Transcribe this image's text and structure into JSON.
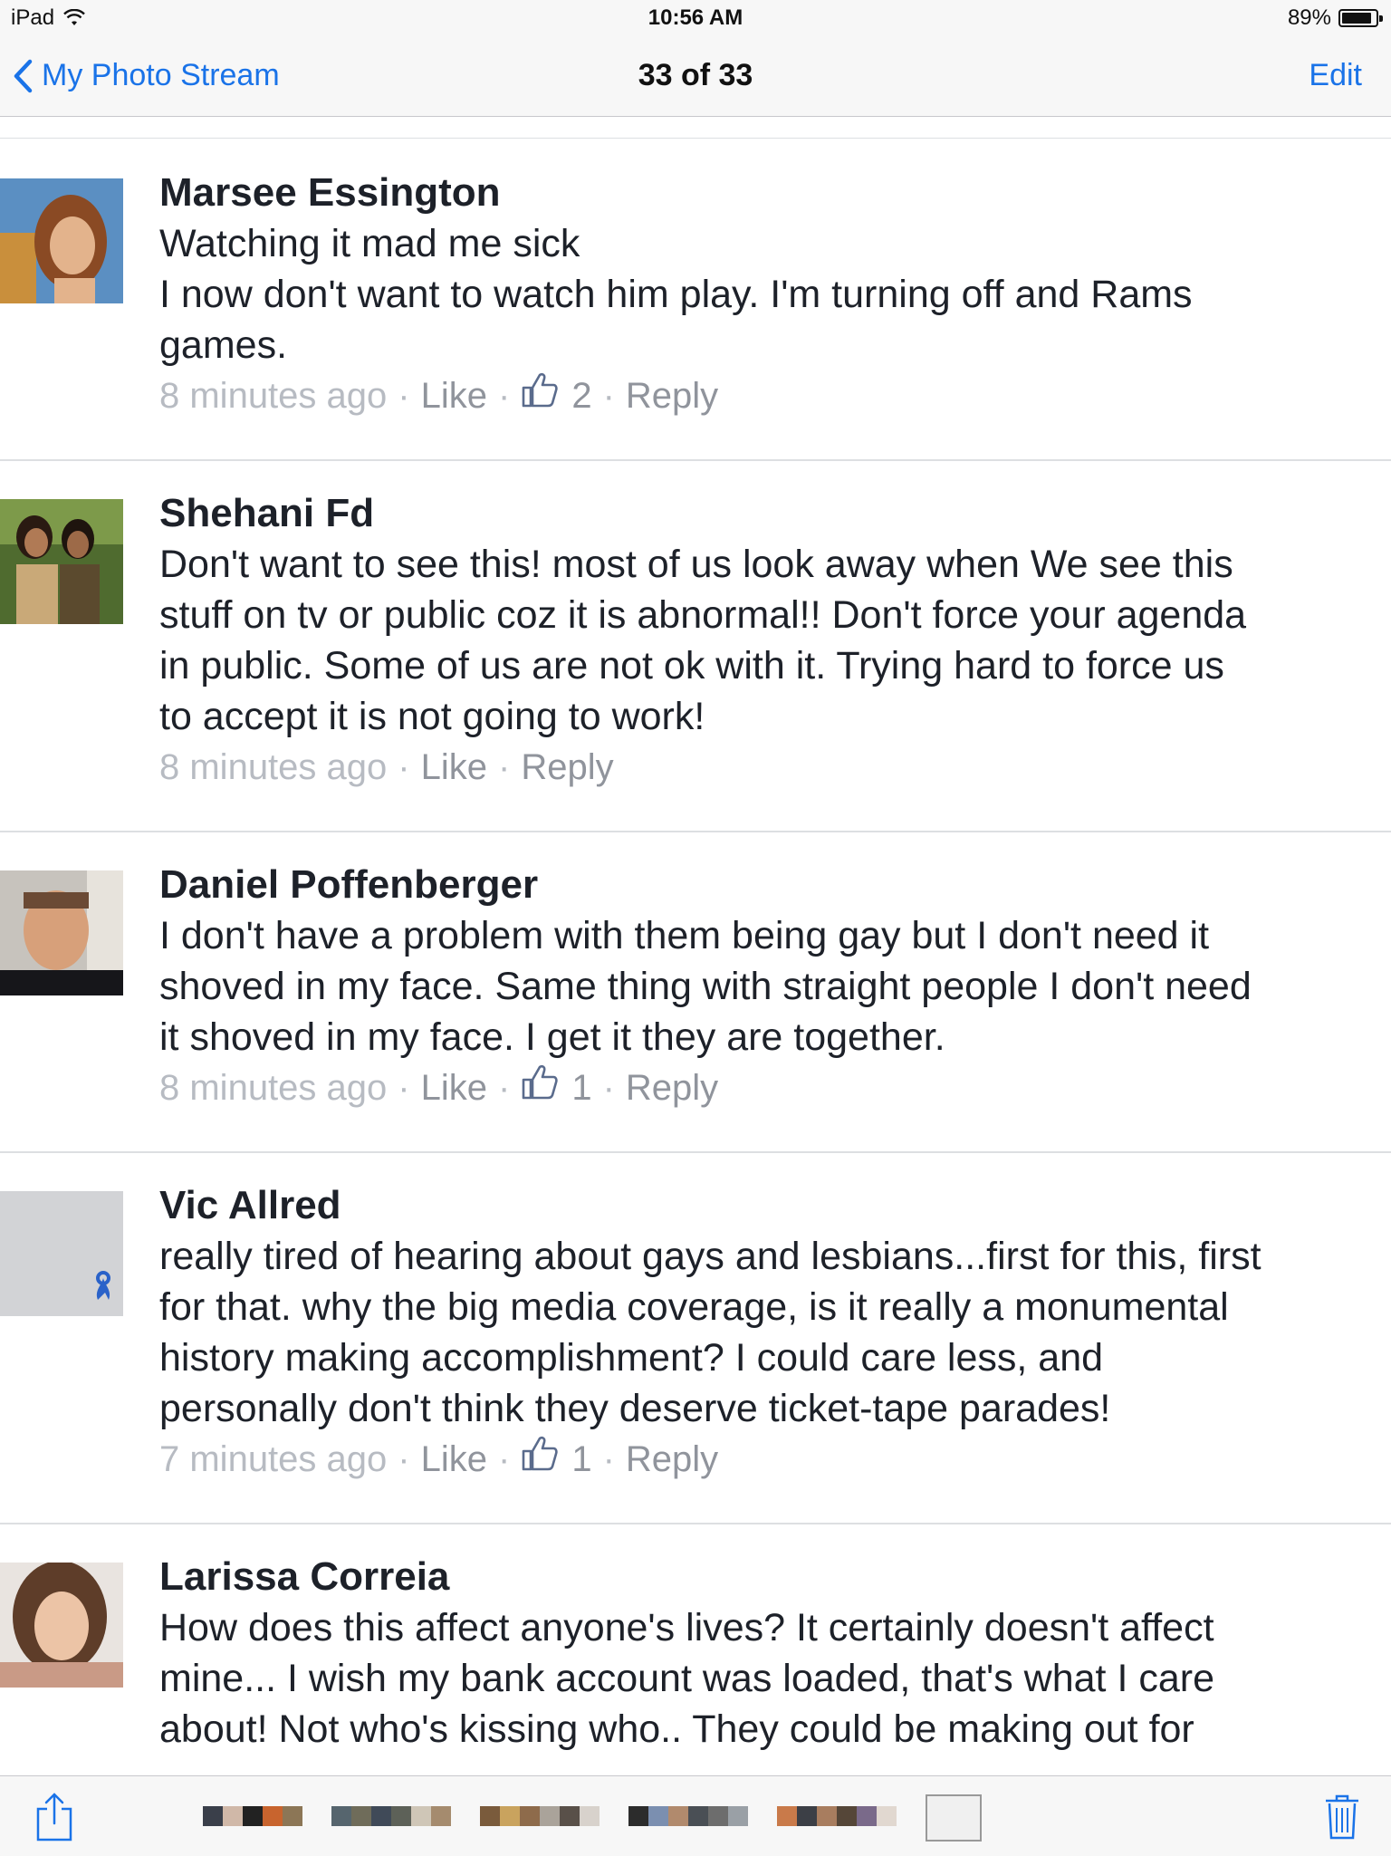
{
  "status_bar": {
    "device": "iPad",
    "time": "10:56 AM",
    "battery": "89%",
    "battery_level": 0.89
  },
  "nav": {
    "back_label": "My Photo Stream",
    "title": "33 of 33",
    "edit_label": "Edit"
  },
  "comments": [
    {
      "name": "Marsee Essington",
      "lines": [
        "Watching it mad me sick",
        "I now don't want to watch him play. I'm turning off and Rams",
        "games."
      ],
      "time": "8 minutes ago",
      "like": "Like",
      "likes": "2",
      "reply": "Reply"
    },
    {
      "name": "Shehani Fd",
      "lines": [
        "Don't want to see this! most of us look away when We see this",
        "stuff on tv or public coz it is abnormal!! Don't force your agenda",
        "in public. Some of us are not ok with it. Trying hard to force us",
        "to accept it is not going to work!"
      ],
      "time": "8 minutes ago",
      "like": "Like",
      "likes": "",
      "reply": "Reply"
    },
    {
      "name": "Daniel Poffenberger",
      "lines": [
        "I don't have a problem with them being gay but I don't need it",
        "shoved in my face. Same thing with straight people I don't need",
        "it shoved in my face. I get it they are together."
      ],
      "time": "8 minutes ago",
      "like": "Like",
      "likes": "1",
      "reply": "Reply"
    },
    {
      "name": "Vic Allred",
      "lines": [
        "really tired of hearing about gays and lesbians...first for this, first",
        "for that. why the big media coverage, is it really a monumental",
        "history making accomplishment? I could care less, and",
        "personally don't think they deserve ticket-tape parades!"
      ],
      "time": "7 minutes ago",
      "like": "Like",
      "likes": "1",
      "reply": "Reply"
    },
    {
      "name": "Larissa Correia",
      "lines": [
        "How does this affect anyone's lives? It certainly doesn't affect",
        "mine... I wish my bank account was loaded, that's what I care",
        "about! Not who's kissing who.. They could be making out for"
      ],
      "time": "",
      "like": "",
      "likes": "",
      "reply": ""
    }
  ],
  "toolbar": {
    "share_icon": "share-icon",
    "trash_icon": "trash-icon"
  }
}
